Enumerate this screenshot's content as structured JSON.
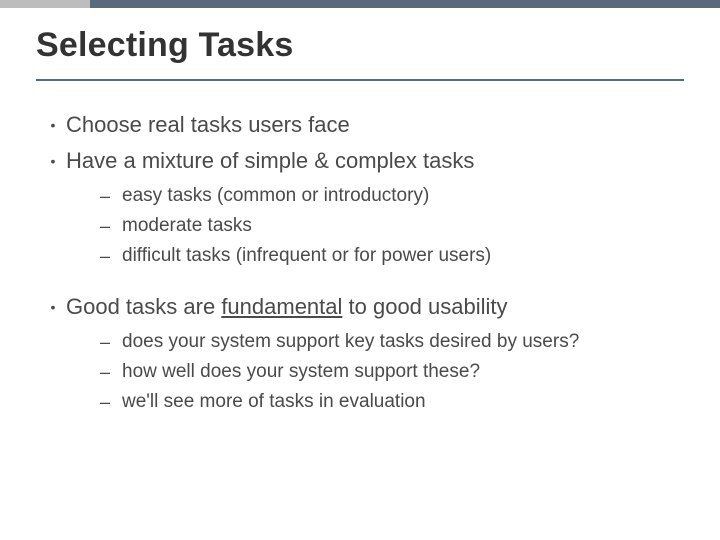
{
  "slide": {
    "title": "Selecting Tasks",
    "bullets": [
      {
        "text": "Choose real tasks users face"
      },
      {
        "text": "Have a mixture of simple & complex tasks",
        "sub": [
          "easy tasks (common or introductory)",
          "moderate tasks",
          "difficult tasks (infrequent or for power users)"
        ]
      },
      {
        "text_before": "Good tasks are ",
        "text_underlined": "fundamental",
        "text_after": " to good usability",
        "sub": [
          "does your system support key tasks desired by users?",
          "how well does your system support these?",
          "we'll see more of tasks in evaluation"
        ]
      }
    ]
  },
  "glyphs": {
    "bullet": "•",
    "dash": "–"
  },
  "colors": {
    "accent": "#5a6a7e",
    "grey": "#bdbdbd",
    "text": "#4a4a4a"
  }
}
